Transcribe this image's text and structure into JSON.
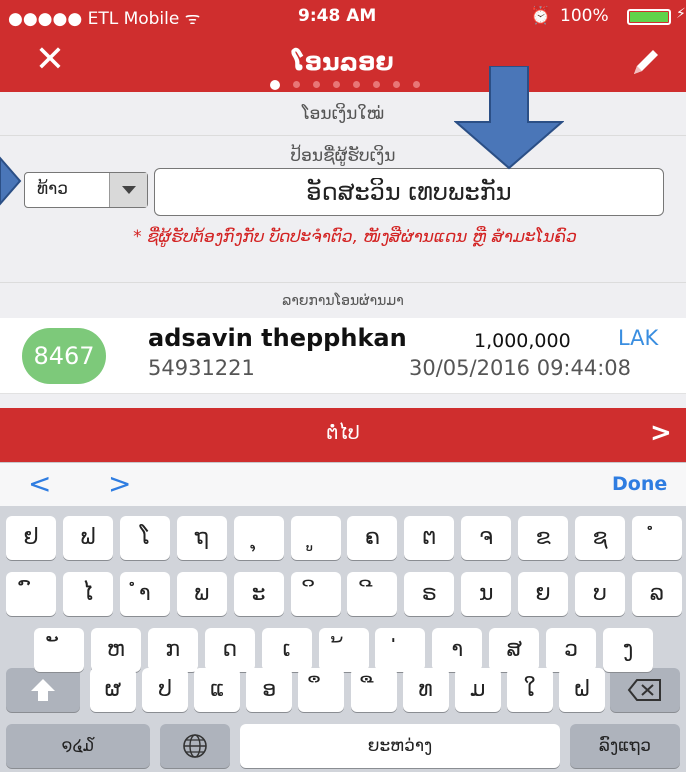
{
  "status_bar": {
    "carrier": "●●●●● ETL Mobile ᯤ",
    "time": "9:48 AM",
    "alarm": "⏰",
    "battery": "100%"
  },
  "nav": {
    "title": "ໂອນລອຍ",
    "close_icon": "✕",
    "page_dots": 8,
    "active_dot": 0
  },
  "form": {
    "section_new_transfer": "ໂອນເງິນໃໝ່",
    "recipient_label": "ປ້ອນຊື່ຜູ້ຮັບເງິນ",
    "title_select": "ທ້າວ",
    "name_value": "ອັດສະວິນ ເທບພະກັນ",
    "warning": "* ຊື່ຜູ້ຮັບຕ້ອງກົງກັບ ບັດປະຈຳຕົວ, ໜັງສືຜ່ານແດນ ຫຼື ສຳມະໂນຄົວ"
  },
  "recent": {
    "header": "ລາຍການໂອນຜ່ານມາ",
    "items": [
      {
        "avatar": "8467",
        "name": "adsavin thepphkan",
        "account": "54931221",
        "amount": "1,000,000",
        "currency": "LAK",
        "date": "30/05/2016 09:44:08"
      }
    ]
  },
  "next_button": {
    "label": "ຕໍ່ໄປ",
    "chevron": ">"
  },
  "keyboard_toolbar": {
    "prev": "<",
    "next": ">",
    "done": "Done"
  },
  "keyboard": {
    "row1": [
      "ຢ",
      "ຟ",
      "ໂ",
      "ຖ",
      "ຸ",
      "ູ",
      "ຄ",
      "ຕ",
      "ຈ",
      "ຂ",
      "ຊ",
      "ໍ"
    ],
    "row2": [
      "ົ",
      "ໄ",
      "ຳ",
      "ພ",
      "ະ",
      "ິ",
      "ີ",
      "ຣ",
      "ນ",
      "ຍ",
      "ບ",
      "ລ"
    ],
    "row3": [
      "ັ",
      "ຫ",
      "ກ",
      "ດ",
      "ເ",
      "້",
      "່",
      "າ",
      "ສ",
      "ວ",
      "ງ"
    ],
    "row4": [
      "ຜ",
      "ປ",
      "ແ",
      "ອ",
      "ຶ",
      "ື",
      "ທ",
      "ມ",
      "ໃ",
      "ຝ"
    ],
    "numbers_key": "໑໔໓",
    "space_key": "ຍະຫວ່າງ",
    "return_key": "ລົງແຖວ"
  },
  "colors": {
    "brand_red": "#cf2e2e",
    "link_blue": "#2f7de1",
    "avatar_green": "#7dc97a",
    "arrow_blue": "#4a76b8"
  }
}
